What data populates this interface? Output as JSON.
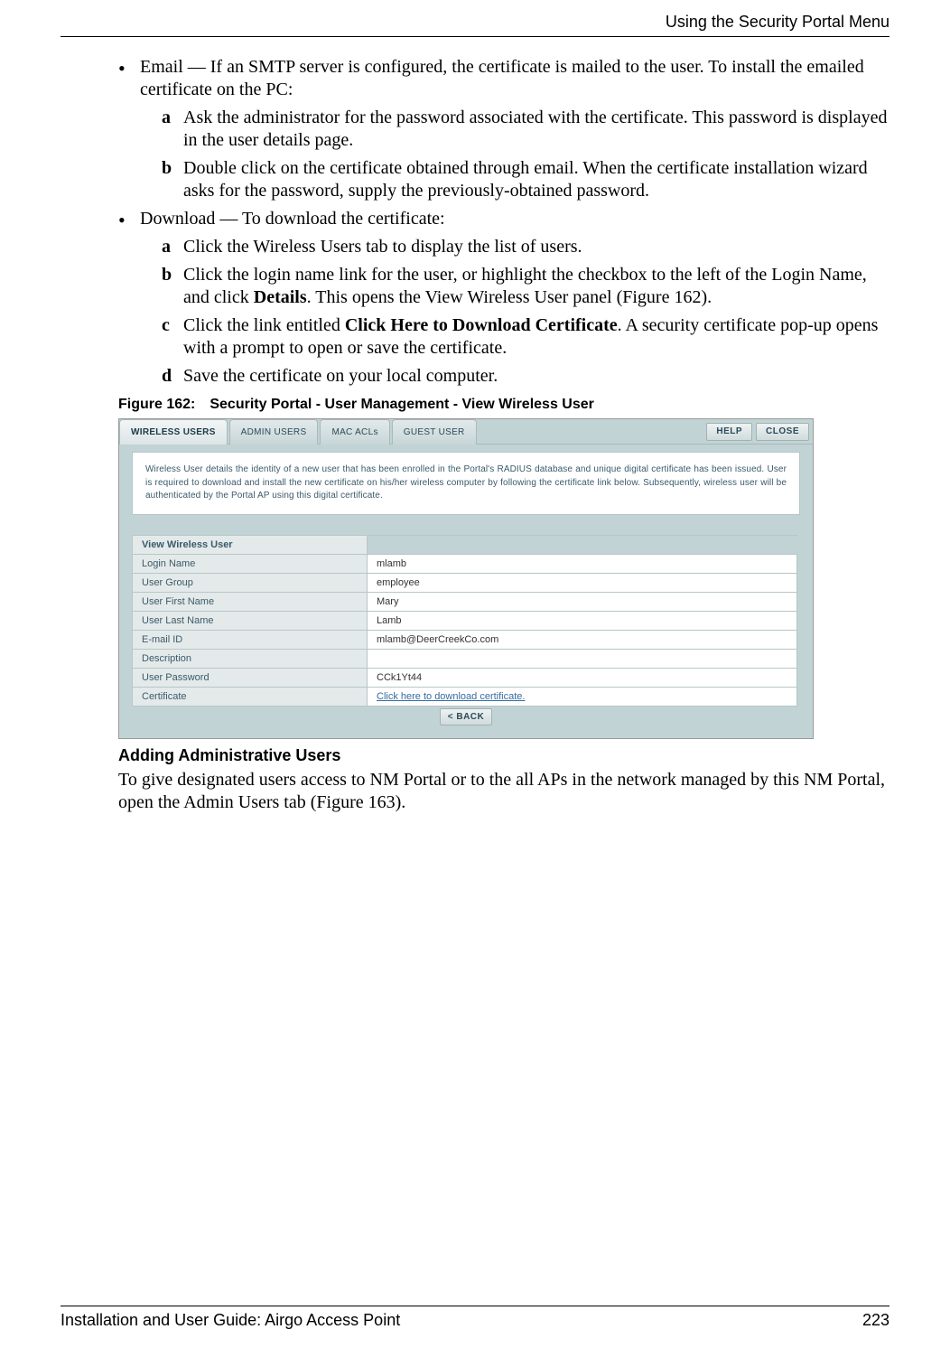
{
  "header": {
    "right": "Using the Security Portal Menu"
  },
  "body": {
    "b1_label": "Email — If an SMTP server is configured, the certificate is mailed to the user. To install the emailed certificate on the PC:",
    "b1_a_letter": "a",
    "b1_a": "Ask the administrator for the password associated with the certificate. This password is displayed in the user details page.",
    "b1_b_letter": "b",
    "b1_b": "Double click on the certificate obtained through email. When the certificate installation wizard asks for the password, supply the previously-obtained password.",
    "b2_label": "Download — To download the certificate:",
    "b2_a_letter": "a",
    "b2_a": "Click the Wireless Users tab to display the list of users.",
    "b2_b_letter": "b",
    "b2_b_pre": "Click the login name link for the user, or highlight the checkbox to the left of the Login Name, and click ",
    "b2_b_bold": "Details",
    "b2_b_post": ". This opens the View Wireless User panel (Figure 162).",
    "b2_c_letter": "c",
    "b2_c_pre": "Click the link entitled ",
    "b2_c_bold": "Click Here to Download Certificate",
    "b2_c_post": ". A security certificate pop-up opens with a prompt to open or save the certificate.",
    "b2_d_letter": "d",
    "b2_d": "Save the certificate on your local computer."
  },
  "figure": {
    "caption": "Figure 162: Security Portal - User Management - View Wireless User",
    "tabs": {
      "t1": "WIRELESS USERS",
      "t2": "ADMIN USERS",
      "t3": "MAC ACLs",
      "t4": "GUEST USER"
    },
    "help": "HELP",
    "close": "CLOSE",
    "info": "Wireless User details the identity of a new user that has been enrolled in the Portal's RADIUS database and unique digital certificate has been issued. User is required to download and install the new certificate on his/her wireless computer by following the certificate link below. Subsequently, wireless user will be authenticated by the Portal AP using this digital certificate.",
    "table_title": "View Wireless User",
    "rows": {
      "r1_l": "Login Name",
      "r1_v": "mlamb",
      "r2_l": "User Group",
      "r2_v": "employee",
      "r3_l": "User First Name",
      "r3_v": "Mary",
      "r4_l": "User Last Name",
      "r4_v": "Lamb",
      "r5_l": "E-mail ID",
      "r5_v": "mlamb@DeerCreekCo.com",
      "r6_l": "Description",
      "r6_v": "",
      "r7_l": "User Password",
      "r7_v": "CCk1Yt44",
      "r8_l": "Certificate",
      "r8_v": "Click here to download certificate."
    },
    "back": "<  BACK"
  },
  "section": {
    "heading": "Adding Administrative Users",
    "para": "To give designated users access to NM Portal or to the all APs in the network managed by this NM Portal, open the Admin Users tab (Figure 163)."
  },
  "footer": {
    "left": "Installation and User Guide: Airgo Access Point",
    "right": "223"
  }
}
